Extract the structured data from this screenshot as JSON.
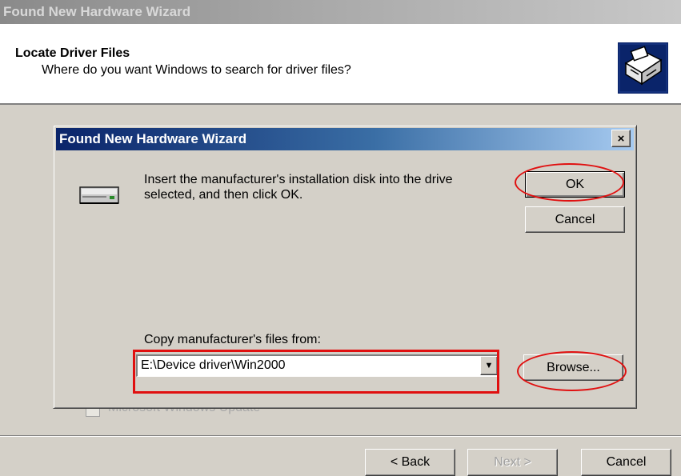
{
  "background_window": {
    "title": "Found New Hardware Wizard",
    "header_title": "Locate Driver Files",
    "header_subtitle": "Where do you want Windows to search for driver files?",
    "ghost_option_label": "Microsoft Windows Update",
    "buttons": {
      "back": "< Back",
      "next": "Next >",
      "cancel": "Cancel"
    }
  },
  "dialog": {
    "title": "Found New Hardware Wizard",
    "close_label": "×",
    "message": "Insert the manufacturer's installation disk into the drive selected, and then click OK.",
    "ok_label": "OK",
    "cancel_label": "Cancel",
    "copy_label": "Copy manufacturer's files from:",
    "path_value": "E:\\Device driver\\Win2000",
    "browse_label": "Browse...",
    "combo_arrow": "▼"
  },
  "annotations": {
    "color": "#e01010"
  },
  "icons": [
    "hardware-wizard-icon",
    "drive-icon",
    "close-icon",
    "dropdown-arrow-icon"
  ]
}
